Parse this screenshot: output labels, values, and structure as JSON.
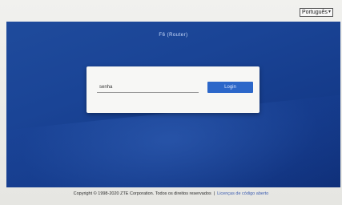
{
  "language_select": {
    "selected": "Português"
  },
  "hero": {
    "product_name": "F6 (Router)"
  },
  "login": {
    "password_value": "senha",
    "button_label": "Login"
  },
  "footer": {
    "copyright": "Copyright © 1998-2020 ZTE Corporation. Todos os direitos reservados",
    "separator": "|",
    "license_link": "Licenças de código aberto"
  },
  "colors": {
    "hero_background": "#1a4496",
    "button": "#2c67c9",
    "page_background": "#e9e9e6"
  }
}
